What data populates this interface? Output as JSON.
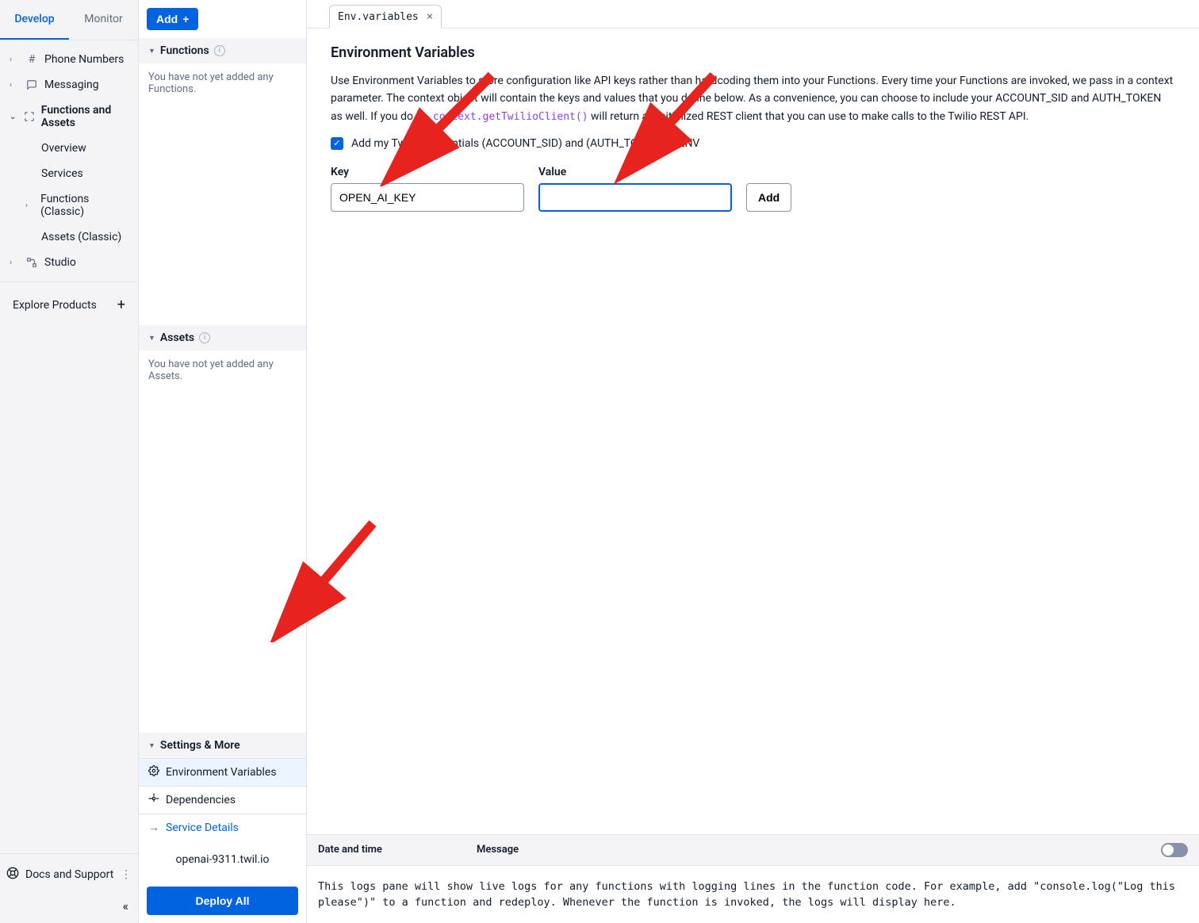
{
  "tabs": {
    "develop": "Develop",
    "monitor": "Monitor"
  },
  "nav": {
    "phone": "Phone Numbers",
    "messaging": "Messaging",
    "functions": "Functions and Assets",
    "overview": "Overview",
    "services": "Services",
    "functions_classic": "Functions (Classic)",
    "assets_classic": "Assets (Classic)",
    "studio": "Studio",
    "explore": "Explore Products",
    "docs": "Docs and Support"
  },
  "mid": {
    "add": "Add",
    "functions_head": "Functions",
    "functions_empty": "You have not yet added any Functions.",
    "assets_head": "Assets",
    "assets_empty": "You have not yet added any Assets.",
    "settings_head": "Settings & More",
    "env_vars": "Environment Variables",
    "dependencies": "Dependencies",
    "service_details": "Service Details",
    "service_url": "openai-9311.twil.io",
    "deploy": "Deploy All"
  },
  "editor": {
    "tab_label": "Env.variables",
    "title": "Environment Variables",
    "desc1": "Use Environment Variables to store configuration like API keys rather than hardcoding them into your Functions. Every time your Functions are invoked, we pass in a context parameter. The context object will contain the keys and values that you define below. As a convenience, you can choose to include your ACCOUNT_SID and AUTH_TOKEN as well. If you do so, ",
    "code": "context.getTwilioClient()",
    "desc2": " will return an initialized REST client that you can use to make calls to the Twilio REST API.",
    "checkbox_label": "Add my Twilio Credentials (ACCOUNT_SID) and (AUTH_TOKEN) to ENV",
    "key_label": "Key",
    "value_label": "Value",
    "key_value": "OPEN_AI_KEY",
    "value_value": "",
    "add_btn": "Add"
  },
  "logs": {
    "col1": "Date and time",
    "col2": "Message",
    "body": "This logs pane will show live logs for any functions with logging lines in the function code. For example, add \"console.log(\"Log this please\")\" to a function and redeploy. Whenever the function is invoked, the logs will display here."
  }
}
